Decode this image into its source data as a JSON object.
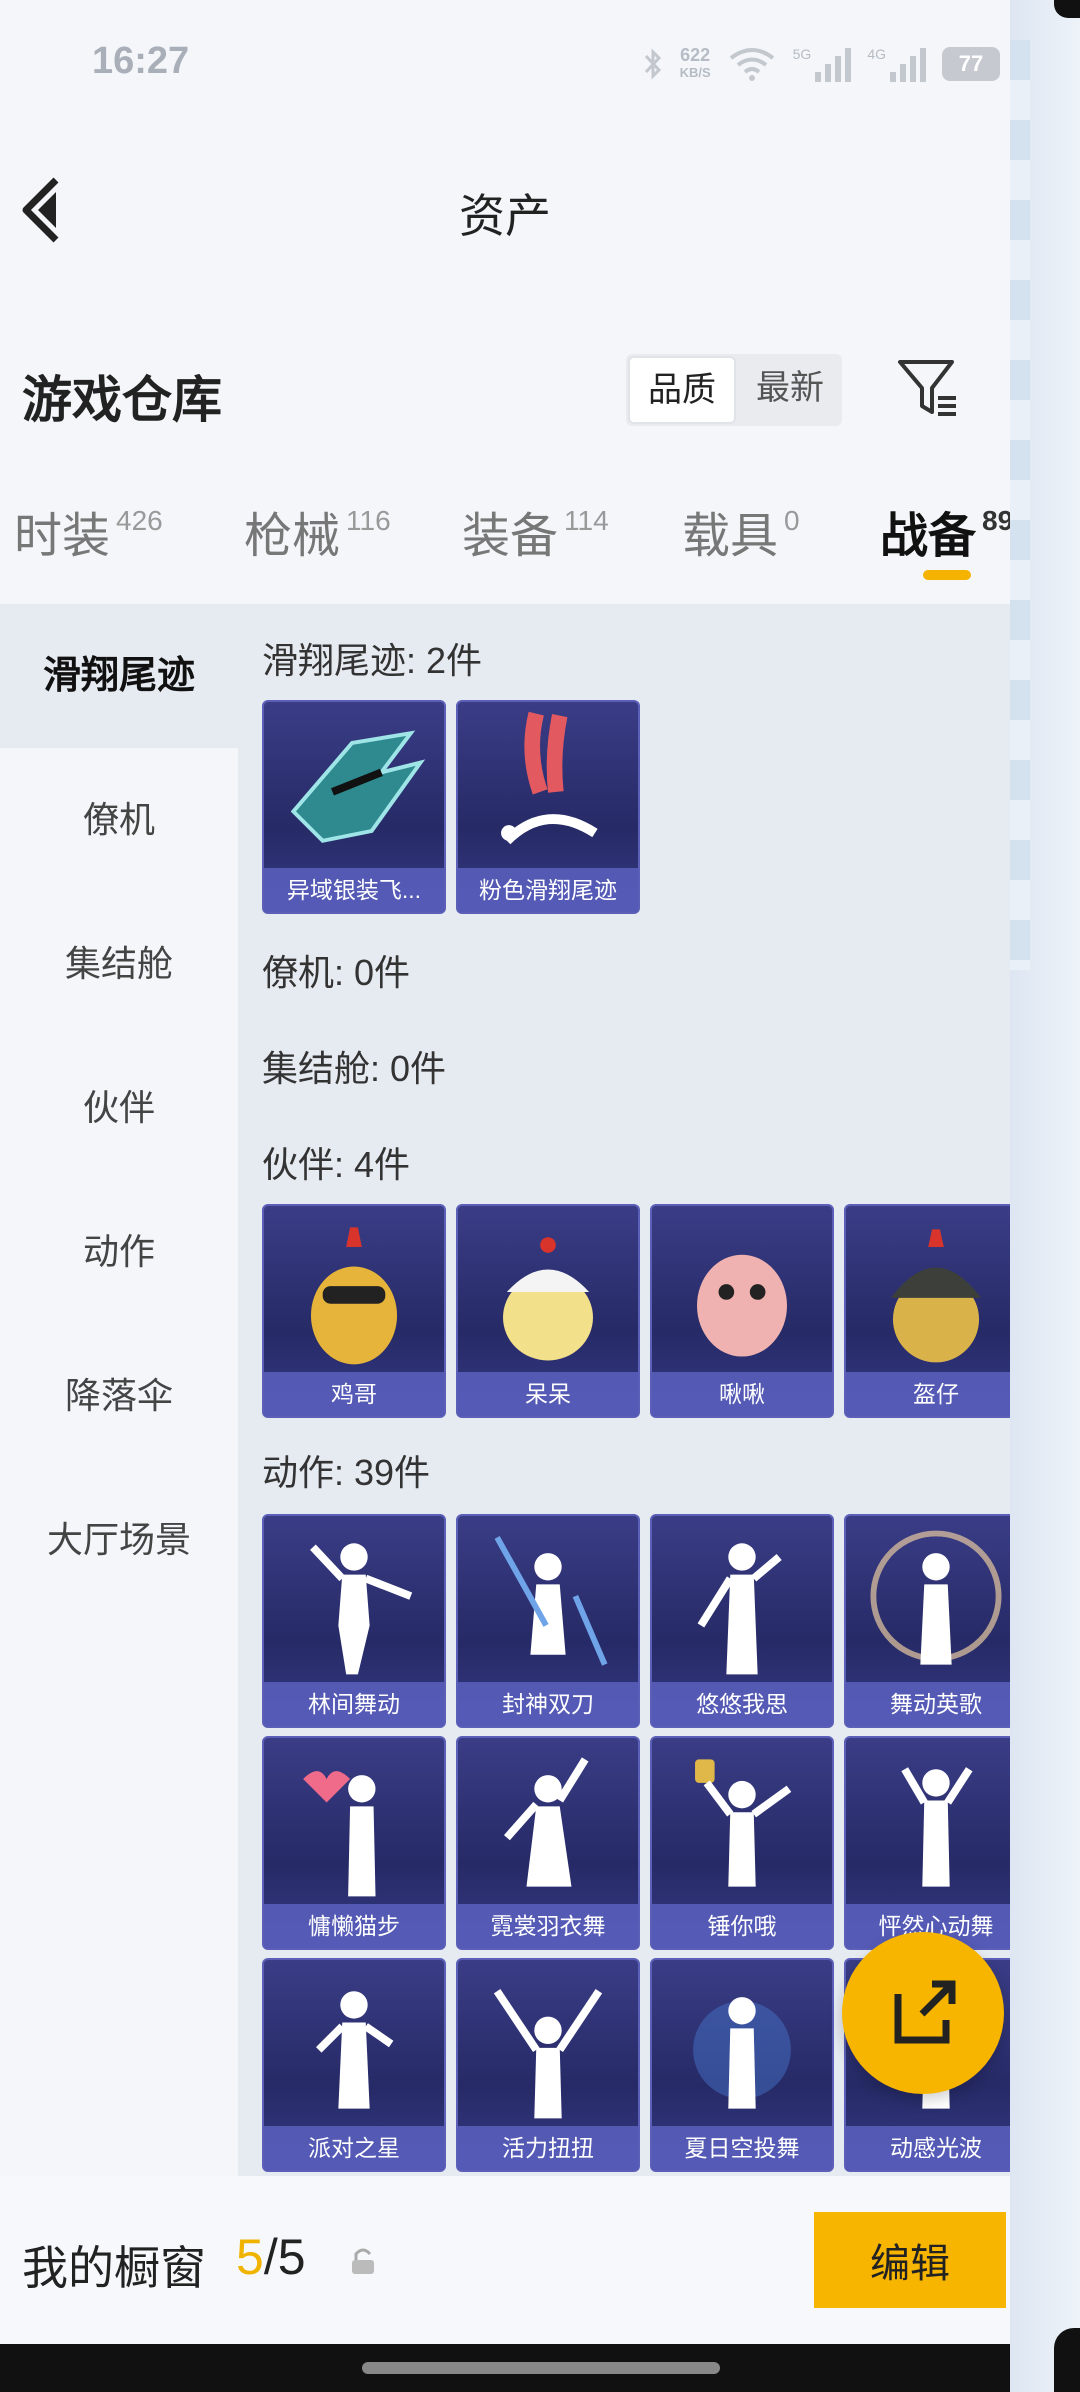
{
  "status_bar": {
    "time": "16:27",
    "net_speed": "622",
    "net_unit": "KB/S",
    "sim1": "5G",
    "sim2": "4G",
    "battery": "77"
  },
  "header": {
    "title": "资产"
  },
  "warehouse": {
    "title": "游戏仓库",
    "sort_quality": "品质",
    "sort_newest": "最新"
  },
  "tabs": [
    {
      "label": "时装",
      "count": "426"
    },
    {
      "label": "枪械",
      "count": "116"
    },
    {
      "label": "装备",
      "count": "114"
    },
    {
      "label": "载具",
      "count": "0"
    },
    {
      "label": "战备",
      "count": "89"
    }
  ],
  "sidebar": [
    "滑翔尾迹",
    "僚机",
    "集结舱",
    "伙伴",
    "动作",
    "降落伞",
    "大厅场景"
  ],
  "groups": {
    "glide": {
      "title": "滑翔尾迹: 2件",
      "items": [
        "异域银装飞...",
        "粉色滑翔尾迹"
      ]
    },
    "wingman": {
      "title": "僚机: 0件"
    },
    "pod": {
      "title": "集结舱: 0件"
    },
    "partner": {
      "title": "伙伴: 4件",
      "items": [
        "鸡哥",
        "呆呆",
        "啾啾",
        "盔仔"
      ]
    },
    "emote": {
      "title": "动作: 39件",
      "items": [
        "林间舞动",
        "封神双刀",
        "悠悠我思",
        "舞动英歌",
        "慵懒猫步",
        "霓裳羽衣舞",
        "锤你哦",
        "怦然心动舞",
        "派对之星",
        "活力扭扭",
        "夏日空投舞",
        "动感光波"
      ]
    }
  },
  "bottom": {
    "showcase_label": "我的橱窗",
    "showcase_current": "5",
    "showcase_sep": "/",
    "showcase_total": "5",
    "edit_label": "编辑"
  },
  "colors": {
    "accent": "#f7b500",
    "card_bg": "#2c3070",
    "card_label": "#5a60be"
  }
}
